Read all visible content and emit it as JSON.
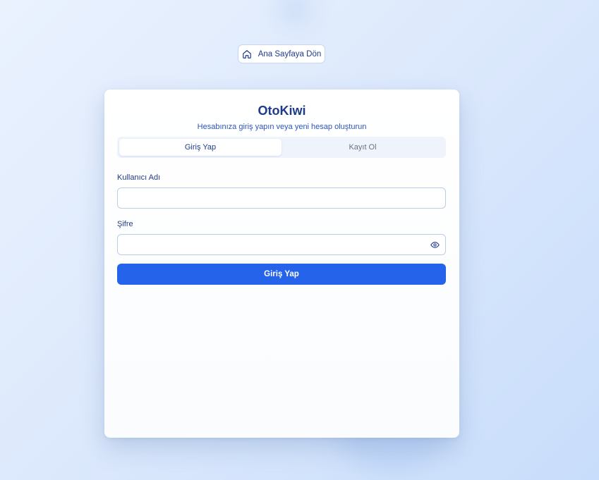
{
  "home_link": {
    "label": "Ana Sayfaya Dön",
    "icon": "home-icon"
  },
  "brand": {
    "title": "OtoKiwi",
    "subtitle": "Hesabınıza giriş yapın veya yeni hesap oluşturun"
  },
  "tabs": [
    {
      "label": "Giriş Yap",
      "active": true
    },
    {
      "label": "Kayıt Ol",
      "active": false
    }
  ],
  "form": {
    "username": {
      "label": "Kullanıcı Adı",
      "value": "",
      "placeholder": ""
    },
    "password": {
      "label": "Şifre",
      "value": "",
      "placeholder": "",
      "toggle_icon": "eye-icon"
    },
    "submit_label": "Giriş Yap"
  },
  "colors": {
    "primary": "#2563eb",
    "heading": "#1e3a8a",
    "tab_background": "#eef3fc",
    "input_border": "#b9cde6"
  }
}
